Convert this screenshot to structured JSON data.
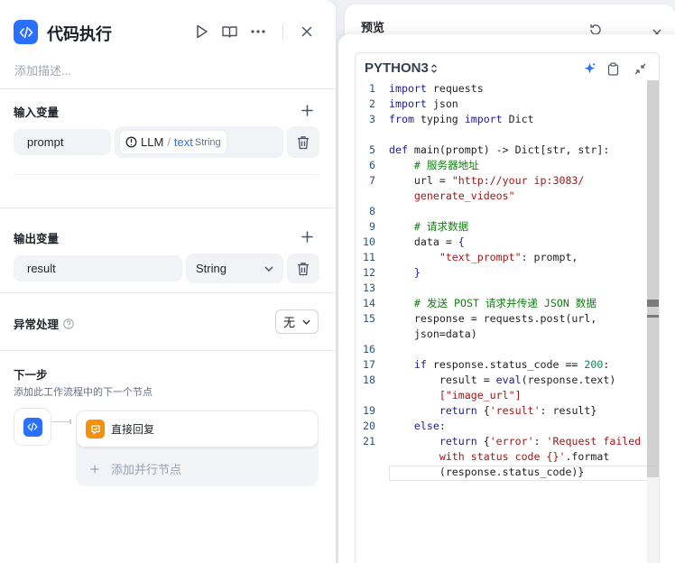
{
  "node": {
    "title": "代码执行",
    "description_placeholder": "添加描述..."
  },
  "input": {
    "label": "输入变量",
    "var_name": "prompt",
    "source_node": "LLM",
    "separator": "/",
    "source_var": "text",
    "source_type": "String"
  },
  "output": {
    "label": "输出变量",
    "var_name": "result",
    "type": "String"
  },
  "error": {
    "label": "异常处理",
    "value": "无"
  },
  "next": {
    "label": "下一步",
    "description": "添加此工作流程中的下一个节点",
    "node_label": "直接回复",
    "add_parallel": "添加并行节点"
  },
  "preview": {
    "title": "预览"
  },
  "editor": {
    "language": "PYTHON3",
    "lines": [
      {
        "n": "1",
        "t": [
          [
            "kw",
            "import"
          ],
          [
            "fn",
            " requests"
          ]
        ]
      },
      {
        "n": "2",
        "t": [
          [
            "kw",
            "import"
          ],
          [
            "fn",
            " json"
          ]
        ]
      },
      {
        "n": "3",
        "t": [
          [
            "kw",
            "from"
          ],
          [
            "fn",
            " typing "
          ],
          [
            "kw",
            "import"
          ],
          [
            "fn",
            " Dict"
          ]
        ]
      },
      {
        "n": "",
        "t": []
      },
      {
        "n": "5",
        "t": [
          [
            "kw",
            "def"
          ],
          [
            "fn",
            " main(prompt) -> Dict[str, str]:"
          ]
        ]
      },
      {
        "n": "6",
        "t": [
          [
            "cm",
            "    # 服务器地址"
          ]
        ]
      },
      {
        "n": "7",
        "t": [
          [
            "fn",
            "    url = "
          ],
          [
            "st",
            "\"http://your ip:3083/"
          ]
        ]
      },
      {
        "n": "",
        "t": [
          [
            "st",
            "    generate_videos\""
          ]
        ]
      },
      {
        "n": "8",
        "t": []
      },
      {
        "n": "9",
        "t": [
          [
            "cm",
            "    # 请求数据"
          ]
        ]
      },
      {
        "n": "10",
        "t": [
          [
            "fn",
            "    data = "
          ],
          [
            "bk",
            "{"
          ]
        ]
      },
      {
        "n": "11",
        "t": [
          [
            "st",
            "        \"text_prompt\""
          ],
          [
            "fn",
            ": prompt,"
          ]
        ]
      },
      {
        "n": "12",
        "t": [
          [
            "bk",
            "    }"
          ]
        ]
      },
      {
        "n": "13",
        "t": []
      },
      {
        "n": "14",
        "t": [
          [
            "cm",
            "    # 发送 POST 请求并传递 JSON 数据"
          ]
        ]
      },
      {
        "n": "15",
        "t": [
          [
            "fn",
            "    response = requests.post(url,"
          ]
        ]
      },
      {
        "n": "",
        "t": [
          [
            "fn",
            "    json=data)"
          ]
        ]
      },
      {
        "n": "16",
        "t": []
      },
      {
        "n": "17",
        "t": [
          [
            "kw",
            "    if"
          ],
          [
            "fn",
            " response.status_code == "
          ],
          [
            "nm",
            "200"
          ],
          [
            "fn",
            ":"
          ]
        ]
      },
      {
        "n": "18",
        "t": [
          [
            "fn",
            "        result = "
          ],
          [
            "kw",
            "eval"
          ],
          [
            "fn",
            "(response.text)"
          ]
        ]
      },
      {
        "n": "",
        "t": [
          [
            "st",
            "        [\"image_url\"]"
          ]
        ]
      },
      {
        "n": "19",
        "t": [
          [
            "kw",
            "        return"
          ],
          [
            "fn",
            " {"
          ],
          [
            "st",
            "'result'"
          ],
          [
            "fn",
            ": result}"
          ]
        ]
      },
      {
        "n": "20",
        "t": [
          [
            "kw",
            "    else"
          ],
          [
            "fn",
            ":"
          ]
        ]
      },
      {
        "n": "21",
        "t": [
          [
            "kw",
            "        return"
          ],
          [
            "fn",
            " {"
          ],
          [
            "st",
            "'error'"
          ],
          [
            "fn",
            ": "
          ],
          [
            "st",
            "'Request failed"
          ]
        ]
      },
      {
        "n": "",
        "t": [
          [
            "st",
            "        with status code {}'"
          ],
          [
            "fn",
            ".format"
          ]
        ]
      },
      {
        "n": "",
        "t": [
          [
            "fn",
            "        (response.status_code)}"
          ]
        ]
      }
    ]
  },
  "colors": {
    "accent": "#2970ff",
    "orange": "#f79009"
  }
}
